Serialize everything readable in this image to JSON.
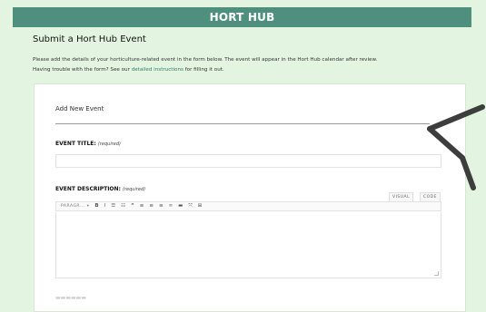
{
  "header": {
    "title": "HORT HUB"
  },
  "page": {
    "title": "Submit a Hort Hub Event",
    "intro_line1": "Please add the details of your horticulture-related event in the form below. The event will appear in the Hort Hub calendar after review.",
    "intro_line2_pre": "Having trouble with the form? See our ",
    "intro_link": "detailed instructions",
    "intro_line2_post": " for filling it out."
  },
  "form": {
    "section_heading": "Add New Event",
    "event_title_label": "EVENT TITLE:",
    "event_title_required": "(required)",
    "event_title_value": "",
    "event_description_label": "EVENT DESCRIPTION:",
    "event_description_required": "(required)",
    "editor_tab_visual": "VISUAL",
    "editor_tab_code": "CODE",
    "toolbar": {
      "format_select": "PARAGR...",
      "bold": "B",
      "italic": "I",
      "quote": "“",
      "more": "⊞"
    }
  },
  "colors": {
    "header_bg": "#4f8f7d",
    "page_bg": "#e3f5e1",
    "link": "#2f7a68"
  },
  "icons": [
    "bold-icon",
    "italic-icon",
    "bullet-list-icon",
    "numbered-list-icon",
    "blockquote-icon",
    "align-left-icon",
    "align-center-icon",
    "align-right-icon",
    "link-icon",
    "horizontal-rule-icon",
    "fullscreen-icon",
    "table-icon"
  ]
}
